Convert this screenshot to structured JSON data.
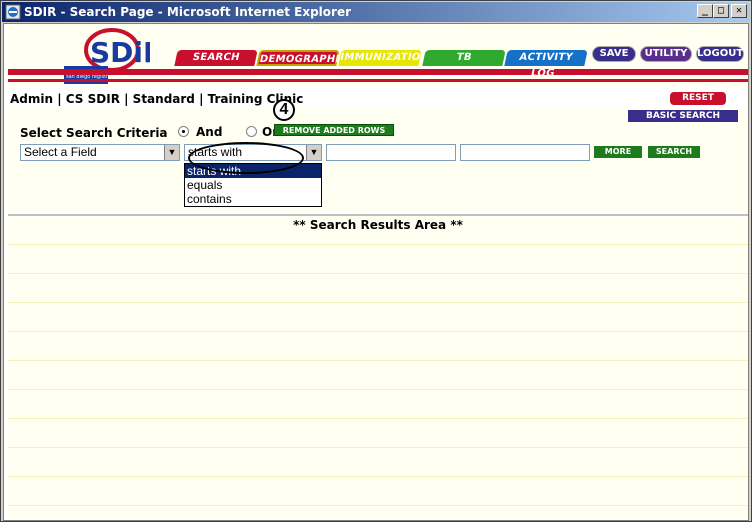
{
  "window": {
    "title": "SDIR - Search Page - Microsoft Internet Explorer",
    "buttons": {
      "minimize": "_",
      "maximize": "□",
      "close": "✕"
    }
  },
  "header": {
    "logo_text": "SDiR",
    "logo_subtext": "san diego immunization registry",
    "tabs": [
      "SEARCH",
      "DEMOGRAPHICS",
      "IMMUNIZATION",
      "TB",
      "ACTIVITY LOG"
    ],
    "actions": {
      "save": "SAVE",
      "utility": "UTILITY",
      "logout": "LOGOUT"
    }
  },
  "breadcrumb": "Admin | CS SDIR | Standard | Training Clinic",
  "reset_label": "RESET",
  "basic_search_label": "BASIC SEARCH",
  "criteria": {
    "label": "Select Search Criteria",
    "and_label": "And",
    "or_label": "Or",
    "selected_logic": "And",
    "remove_label": "REMOVE ADDED ROWS",
    "field_select": "Select a Field",
    "operator_select": "starts with",
    "operator_options": [
      "starts with",
      "equals",
      "contains"
    ],
    "value1": "",
    "value2": "",
    "more_label": "MORE",
    "search_label": "SEARCH"
  },
  "callout_number": "4",
  "results_label": "** Search Results Area **"
}
